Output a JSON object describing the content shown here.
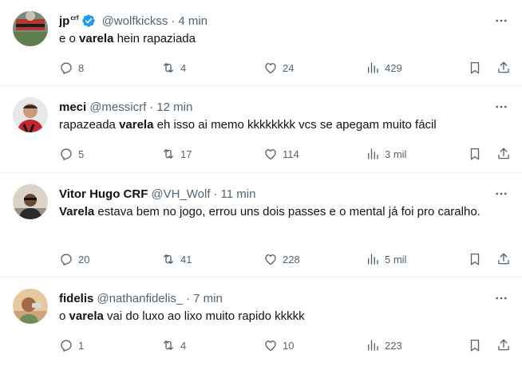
{
  "tweets": [
    {
      "name": "jp",
      "name_sup": "crf",
      "verified": true,
      "handle": "@wolfkickss",
      "separator": "·",
      "time": "4 min",
      "text_before": "e o ",
      "text_bold": "varela",
      "text_after": " hein rapaziada",
      "replies": "8",
      "retweets": "4",
      "likes": "24",
      "views": "429"
    },
    {
      "name": "meci",
      "handle": "@messicrf",
      "separator": "·",
      "time": "12 min",
      "text_before": "rapazeada ",
      "text_bold": "varela",
      "text_after": " eh isso ai memo kkkkkkkk vcs se apegam muito fácil",
      "replies": "5",
      "retweets": "17",
      "likes": "114",
      "views": "3 mil"
    },
    {
      "name": "Vitor Hugo CRF",
      "handle": "@VH_Wolf",
      "separator": "·",
      "time": "11 min",
      "text_before": "",
      "text_bold": "Varela",
      "text_after": " estava bem no jogo, errou uns dois passes e o mental já foi pro caralho.",
      "replies": "20",
      "retweets": "41",
      "likes": "228",
      "views": "5 mil"
    },
    {
      "name": "fidelis",
      "handle": "@nathanfidelis_",
      "separator": "·",
      "time": "7 min",
      "text_before": "o ",
      "text_bold": "varela",
      "text_after": " vai do luxo ao lixo muito rapido kkkkk",
      "replies": "1",
      "retweets": "4",
      "likes": "10",
      "views": "223"
    }
  ],
  "colors": {
    "text": "#0f1419",
    "secondary": "#536471",
    "verified": "#1d9bf0",
    "divider": "#eff3f4"
  },
  "icons": [
    "reply-icon",
    "retweet-icon",
    "like-icon",
    "views-icon",
    "bookmark-icon",
    "share-icon",
    "more-icon",
    "verified-icon"
  ]
}
